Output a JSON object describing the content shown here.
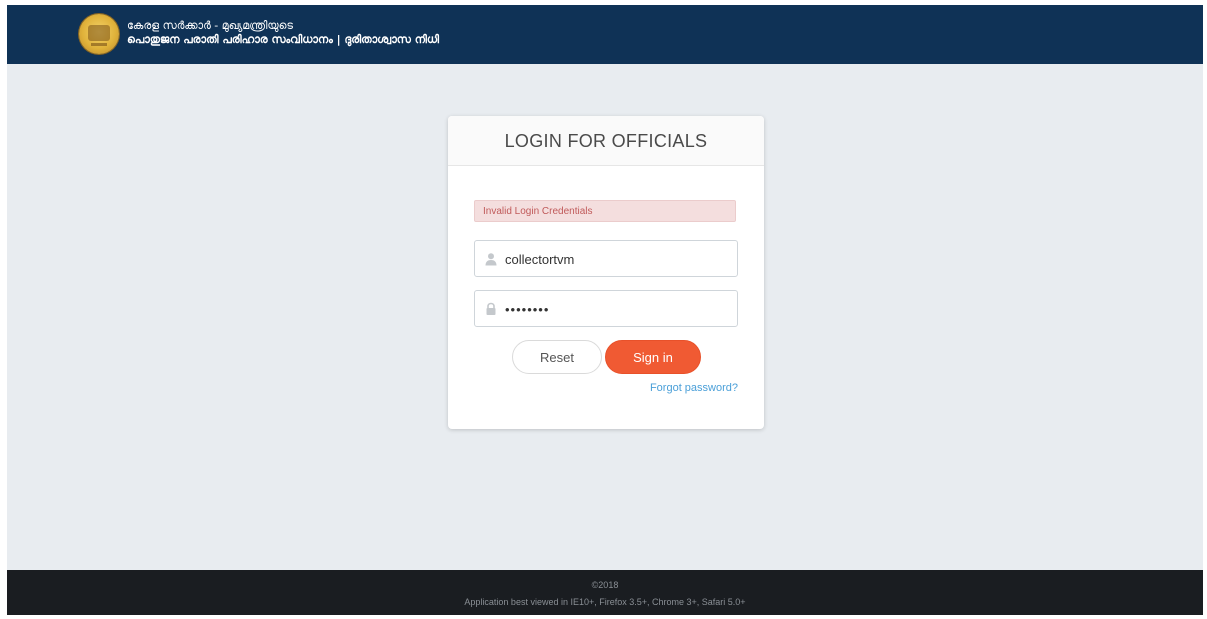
{
  "header": {
    "line1": "കേരള സർക്കാർ - മുഖ്യമന്ത്രിയുടെ",
    "line2": "പൊതുജന പരാതി പരിഹാര സംവിധാനം | ദുരിതാശ്വാസ നിധി",
    "emblem_icon": "kerala-emblem-icon",
    "background_color": "#0f3256"
  },
  "login": {
    "title": "LOGIN FOR OFFICIALS",
    "error_message": "Invalid Login Credentials",
    "username": {
      "value": "collectortvm",
      "icon": "user-icon"
    },
    "password": {
      "value": "••••••••",
      "icon": "lock-icon"
    },
    "reset_label": "Reset",
    "signin_label": "Sign in",
    "forgot_label": "Forgot password?",
    "accent_color": "#f05a33",
    "link_color": "#4a9fd8"
  },
  "footer": {
    "copyright": "©2018",
    "browser_note": "Application best viewed in IE10+, Firefox 3.5+, Chrome 3+, Safari 5.0+"
  }
}
